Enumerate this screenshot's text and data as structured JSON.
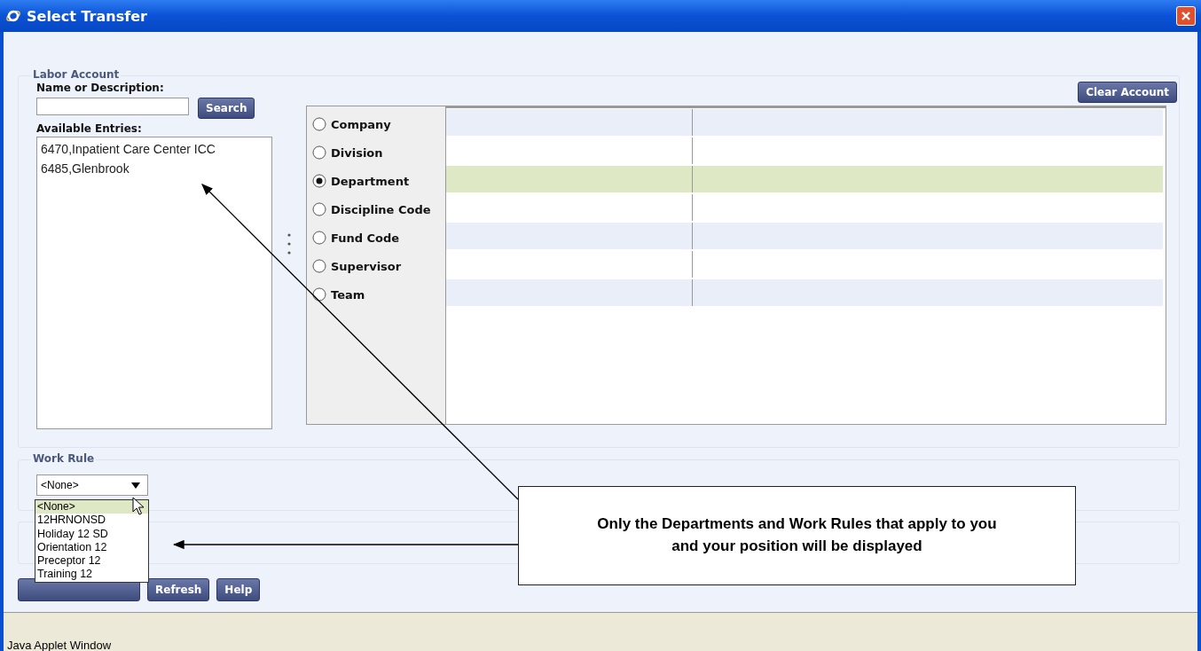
{
  "window": {
    "title": "Select Transfer"
  },
  "labor_account": {
    "legend": "Labor Account",
    "name_label": "Name or Description:",
    "search_button": "Search",
    "entries_label": "Available Entries:",
    "clear_button": "Clear Account",
    "entries": [
      "6470,Inpatient Care Center ICC",
      "6485,Glenbrook"
    ],
    "levels": [
      {
        "label": "Company",
        "selected": false
      },
      {
        "label": "Division",
        "selected": false
      },
      {
        "label": "Department",
        "selected": true
      },
      {
        "label": "Discipline Code",
        "selected": false
      },
      {
        "label": "Fund Code",
        "selected": false
      },
      {
        "label": "Supervisor",
        "selected": false
      },
      {
        "label": "Team",
        "selected": false
      }
    ]
  },
  "work_rule": {
    "legend": "Work Rule",
    "value": "<None>",
    "options": [
      {
        "label": "<None>",
        "selected": true
      },
      {
        "label": "12HRNONSD",
        "selected": false
      },
      {
        "label": "Holiday 12 SD",
        "selected": false
      },
      {
        "label": "Orientation 12",
        "selected": false
      },
      {
        "label": "Preceptor 12",
        "selected": false
      },
      {
        "label": "Training 12",
        "selected": false
      }
    ]
  },
  "buttons": [
    "Refresh",
    "Help"
  ],
  "callout": {
    "text": "Only the Departments and Work Rules that apply to you and your position will be displayed"
  },
  "status_bar": "Java Applet Window"
}
